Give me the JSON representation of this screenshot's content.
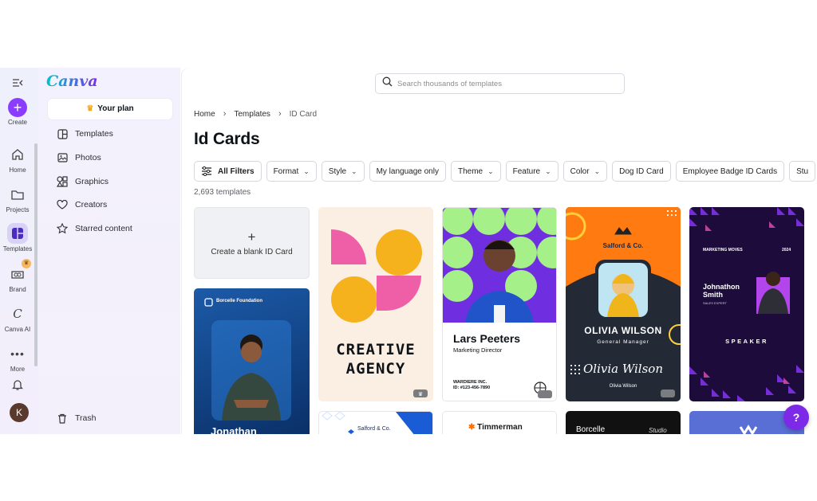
{
  "rail": {
    "create": "Create",
    "home": "Home",
    "projects": "Projects",
    "templates": "Templates",
    "brand": "Brand",
    "canva_ai": "Canva AI",
    "more": "More",
    "avatar_initial": "K"
  },
  "sidebar": {
    "logo": "Canva",
    "your_plan": "Your plan",
    "items": [
      {
        "label": "Templates",
        "icon": "templates-icon"
      },
      {
        "label": "Photos",
        "icon": "photo-icon"
      },
      {
        "label": "Graphics",
        "icon": "shapes-icon"
      },
      {
        "label": "Creators",
        "icon": "heart-icon"
      },
      {
        "label": "Starred content",
        "icon": "star-icon"
      }
    ],
    "trash": "Trash"
  },
  "search": {
    "placeholder": "Search thousands of templates"
  },
  "breadcrumb": [
    "Home",
    "Templates",
    "ID Card"
  ],
  "page_title": "Id Cards",
  "filters": {
    "all_filters": "All Filters",
    "chips": [
      "Format",
      "Style",
      "My language only",
      "Theme",
      "Feature",
      "Color",
      "Dog ID Card",
      "Employee Badge ID Cards",
      "Stu"
    ]
  },
  "result_count": "2,693 templates",
  "blank_card": "Create a blank ID Card",
  "templates": {
    "t1": {
      "brand": "Borcelle Foundation",
      "name": "Jonathan"
    },
    "t2": {
      "line1": "CREATIVE",
      "line2": "AGENCY"
    },
    "t3": {
      "name": "Lars Peeters",
      "title": "Marketing Director",
      "company": "WARDIERE INC.",
      "id": "ID: #123-456-7890"
    },
    "t4": {
      "company": "Salford & Co.",
      "name": "OLIVIA WILSON",
      "title": "General Manager",
      "signature": "Olivia Wilson",
      "printed": "Olivia Wilson"
    },
    "t5": {
      "header": "MARKETING MOVES",
      "year": "2024",
      "name1": "Johnathon",
      "name2": "Smith",
      "role": "SALES EXPERT",
      "badge": "SPEAKER"
    },
    "r2": {
      "salford": "Salford & Co.",
      "timmerman": "Timmerman",
      "borcelle": "Borcelle",
      "studio": "Studio"
    }
  },
  "help": "?",
  "colors": {
    "accent": "#8b3dff",
    "help": "#7d2ae8"
  }
}
